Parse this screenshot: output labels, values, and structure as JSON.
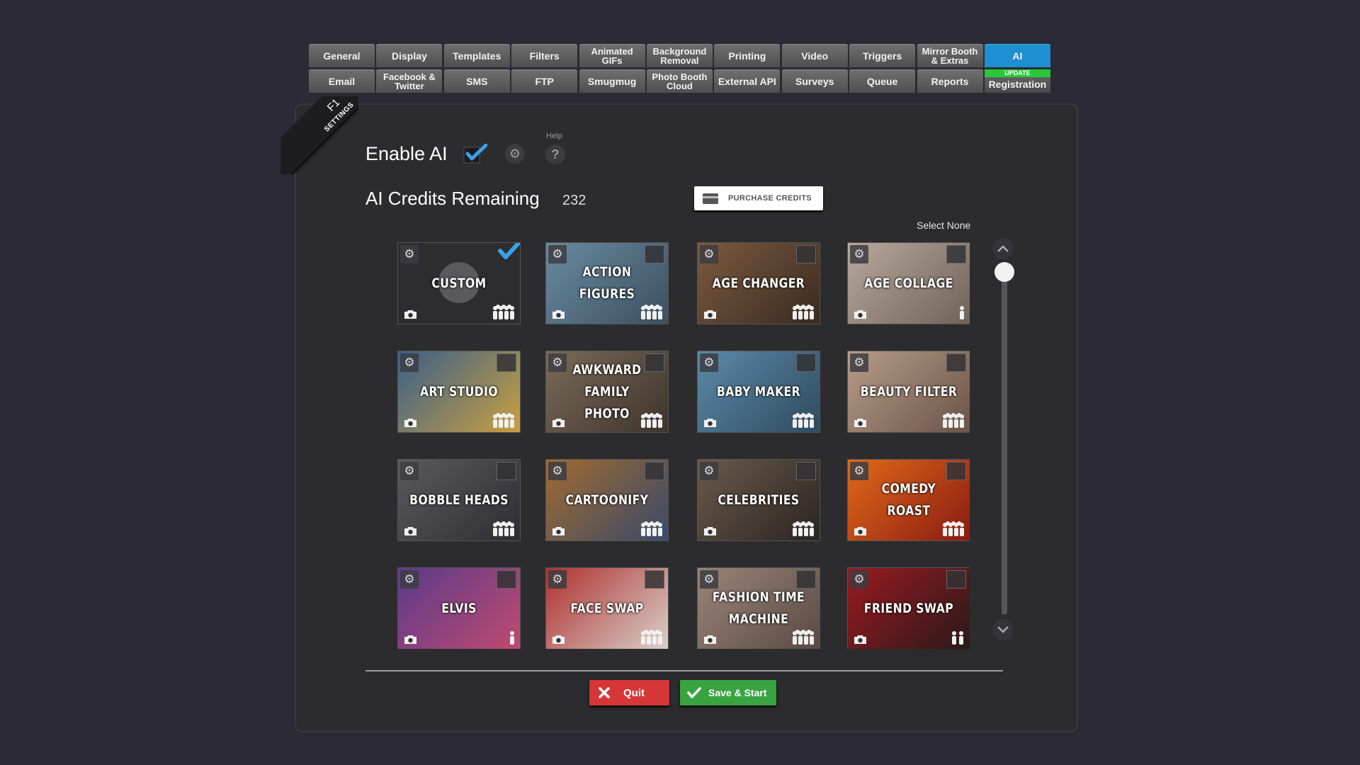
{
  "tabs_row1": [
    {
      "label": "General"
    },
    {
      "label": "Display"
    },
    {
      "label": "Templates"
    },
    {
      "label": "Filters"
    },
    {
      "label": "Animated\nGIFs"
    },
    {
      "label": "Background\nRemoval"
    },
    {
      "label": "Printing"
    },
    {
      "label": "Video"
    },
    {
      "label": "Triggers"
    },
    {
      "label": "Mirror Booth\n& Extras"
    },
    {
      "label": "AI",
      "active": true
    }
  ],
  "tabs_row2": [
    {
      "label": "Email"
    },
    {
      "label": "Facebook &\nTwitter"
    },
    {
      "label": "SMS"
    },
    {
      "label": "FTP"
    },
    {
      "label": "Smugmug"
    },
    {
      "label": "Photo Booth\nCloud"
    },
    {
      "label": "External API"
    },
    {
      "label": "Surveys"
    },
    {
      "label": "Queue"
    },
    {
      "label": "Reports"
    },
    {
      "label": "Registration",
      "badge": "UPDATE"
    }
  ],
  "ribbon": {
    "key": "F1",
    "label": "SETTINGS"
  },
  "enable_ai": {
    "label": "Enable AI",
    "checked": true,
    "help_label": "Help",
    "help_glyph": "?"
  },
  "credits": {
    "label": "AI Credits Remaining",
    "value": "232",
    "purchase_label": "PURCHASE CREDITS"
  },
  "select_none": "Select None",
  "effects": [
    {
      "title": "CUSTOM",
      "checked": true,
      "people": "group",
      "bg": "custom"
    },
    {
      "title": "ACTION FIGURES",
      "checked": false,
      "people": "group",
      "bg": [
        "#6a8aa0",
        "#3b4f60"
      ]
    },
    {
      "title": "AGE CHANGER",
      "checked": false,
      "people": "group",
      "bg": [
        "#7b5a40",
        "#3a2a20"
      ]
    },
    {
      "title": "AGE COLLAGE",
      "checked": false,
      "people": "single",
      "bg": [
        "#b9a89c",
        "#6e625a"
      ]
    },
    {
      "title": "ART STUDIO",
      "checked": false,
      "people": "group",
      "bg": [
        "#3a5f8a",
        "#c9a040"
      ]
    },
    {
      "title": "AWKWARD FAMILY\nPHOTO",
      "checked": false,
      "people": "group",
      "bg": [
        "#7a6a58",
        "#3e342c"
      ]
    },
    {
      "title": "BABY MAKER",
      "checked": false,
      "people": "group",
      "bg": [
        "#5c8aa8",
        "#2f4a5e"
      ]
    },
    {
      "title": "BEAUTY FILTER",
      "checked": false,
      "people": "group",
      "bg": [
        "#b89c88",
        "#6a5448"
      ]
    },
    {
      "title": "BOBBLE HEADS",
      "checked": false,
      "people": "group",
      "bg": [
        "#5a5a5e",
        "#2e2e32"
      ]
    },
    {
      "title": "CARTOONIFY",
      "checked": false,
      "people": "group",
      "bg": [
        "#a06a30",
        "#3a4a6a"
      ]
    },
    {
      "title": "CELEBRITIES",
      "checked": false,
      "people": "group",
      "bg": [
        "#6a5a4a",
        "#2a2422"
      ]
    },
    {
      "title": "COMEDY ROAST",
      "checked": false,
      "people": "group",
      "bg": [
        "#e06a1a",
        "#8a1a12"
      ]
    },
    {
      "title": "ELVIS",
      "checked": false,
      "people": "single",
      "bg": [
        "#5a3a8a",
        "#c04a70"
      ]
    },
    {
      "title": "FACE SWAP",
      "checked": false,
      "people": "group",
      "bg": [
        "#b03030",
        "#d8d0c8"
      ]
    },
    {
      "title": "FASHION TIME\nMACHINE",
      "checked": false,
      "people": "group",
      "bg": [
        "#9a8478",
        "#5a4a44"
      ]
    },
    {
      "title": "FRIEND SWAP",
      "checked": false,
      "people": "pair",
      "bg": [
        "#9a1a20",
        "#2a1a1a"
      ]
    }
  ],
  "actions": {
    "quit_label": "Quit",
    "save_label": "Save & Start"
  },
  "colors": {
    "accent": "#1e8fd0",
    "check": "#3aa0e8",
    "quit": "#d63636",
    "save": "#3aa341",
    "update_badge": "#27c93a"
  }
}
